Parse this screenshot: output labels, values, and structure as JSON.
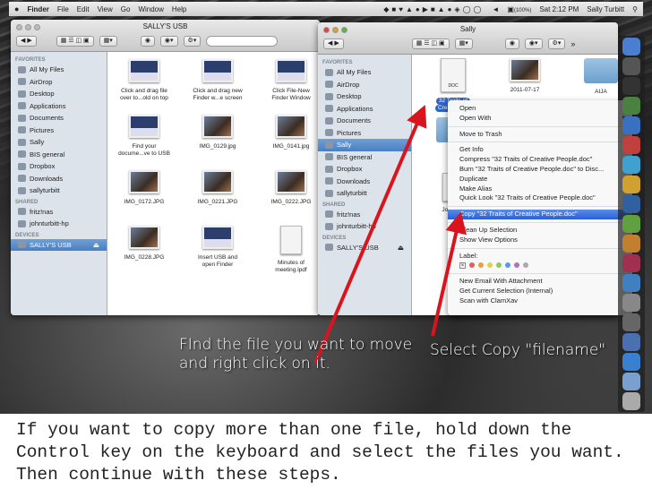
{
  "menubar": {
    "apple": "",
    "items": [
      "Finder",
      "File",
      "Edit",
      "View",
      "Go",
      "Window",
      "Help"
    ],
    "battery": "(100%)",
    "clock": "Sat 2:12 PM",
    "user": "Sally Turbitt"
  },
  "left_window": {
    "title": "SALLY'S USB",
    "search_placeholder": "",
    "sidebar": {
      "favorites_header": "FAVORITES",
      "favorites": [
        "All My Files",
        "AirDrop",
        "Desktop",
        "Applications",
        "Documents",
        "Pictures",
        "Sally",
        "BIS general",
        "Dropbox",
        "Downloads",
        "sallyturbitt"
      ],
      "shared_header": "SHARED",
      "shared": [
        "fritz!nas",
        "johnturbitt-hp"
      ],
      "devices_header": "DEVICES",
      "devices": [
        "SALLY'S USB"
      ],
      "selected": "SALLY'S USB"
    },
    "files": [
      [
        "Click and drag file",
        "over to...old on top"
      ],
      [
        "Click and drag new",
        "Finder w...e screen"
      ],
      [
        "Click File-New",
        "Finder Window"
      ],
      [
        "Find your",
        "docume...ve to USB"
      ],
      [
        "IMG_0129.jpg",
        ""
      ],
      [
        "IMG_0141.jpg",
        ""
      ],
      [
        "IMG_0172.JPG",
        ""
      ],
      [
        "IMG_0221.JPG",
        ""
      ],
      [
        "IMG_0222.JPG",
        ""
      ],
      [
        "IMG_0228.JPG",
        ""
      ],
      [
        "Insert USB and",
        "open Finder"
      ],
      [
        "Minutes of",
        "meeting.lpdf"
      ]
    ]
  },
  "right_window": {
    "title": "Sally",
    "sidebar": {
      "favorites_header": "FAVORITES",
      "favorites": [
        "All My Files",
        "AirDrop",
        "Desktop",
        "Applications",
        "Documents",
        "Pictures",
        "Sally",
        "BIS general",
        "Dropbox",
        "Downloads",
        "sallyturbitt"
      ],
      "shared_header": "SHARED",
      "shared": [
        "fritz!nas",
        "johnturbitt-hp"
      ],
      "devices_header": "DEVICES",
      "devices": [
        "SALLY'S USB"
      ],
      "selected": "Sally"
    },
    "files": [
      [
        "32 Traits of",
        "Creative Pe"
      ],
      [
        "2011-07-17",
        ""
      ],
      [
        "AIJA",
        ""
      ],
      [
        "Jo",
        ""
      ],
      [
        "John QB",
        "11."
      ]
    ],
    "doc_badge": "DOC"
  },
  "context_menu": {
    "groups": [
      [
        "Open",
        "Open With"
      ],
      [
        "Move to Trash"
      ],
      [
        "Get Info",
        "Compress \"32 Traits of Creative People.doc\"",
        "Burn \"32 Traits of Creative People.doc\" to Disc...",
        "Duplicate",
        "Make Alias",
        "Quick Look \"32 Traits of Creative People.doc\""
      ],
      [
        "Copy \"32 Traits of Creative People.doc\""
      ],
      [
        "Clean Up Selection",
        "Show View Options"
      ]
    ],
    "highlighted": "Copy \"32 Traits of Creative People.doc\"",
    "label_title": "Label:",
    "label_none": "×",
    "label_colors": [
      "#e0605a",
      "#e8a040",
      "#e0d050",
      "#90c860",
      "#5a9ae0",
      "#b070c0",
      "#aaaaaa"
    ],
    "extras": [
      "New Email With Attachment",
      "Get Current Selection (Internal)",
      "Scan with ClamXav"
    ]
  },
  "captions": {
    "left": [
      "FInd the file you want to move",
      "and right click on it."
    ],
    "right": "Select Copy \"filename\""
  },
  "arrow_color": "#d8151e",
  "note": "If you want to copy more than one file, hold down the Control key on the keyboard and select the files you want. Then continue with these steps."
}
